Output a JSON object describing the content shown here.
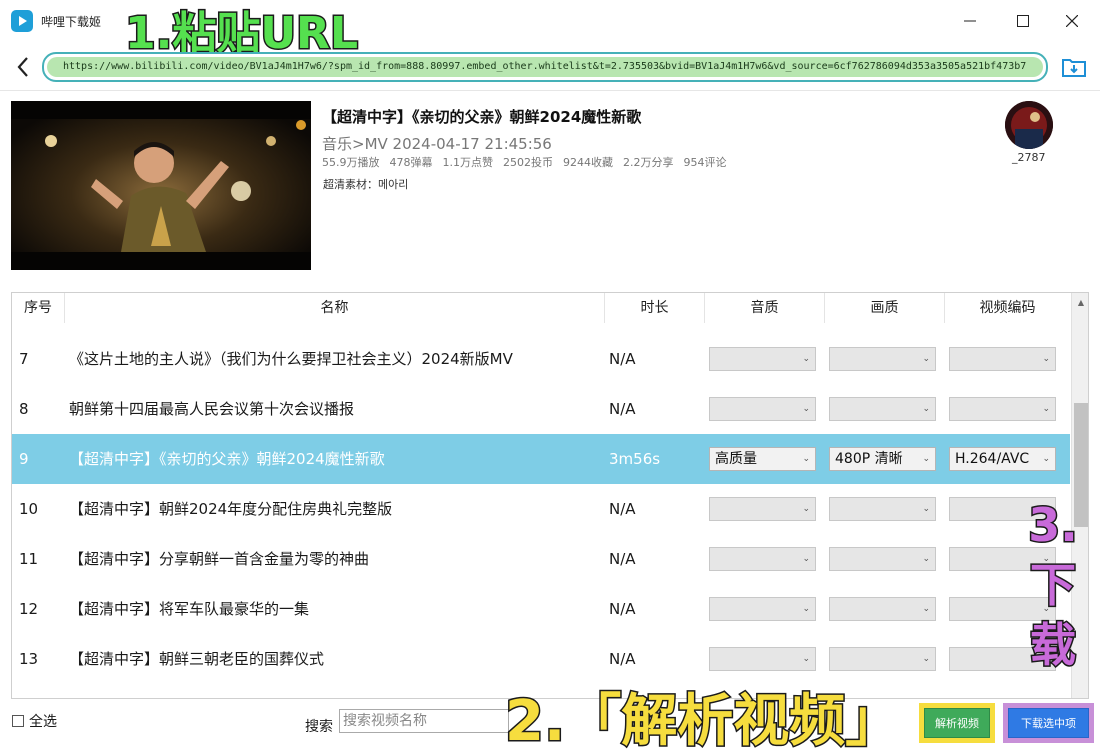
{
  "window": {
    "title": "哔哩下载姬",
    "controls": {
      "minimize": "—",
      "maximize": "☐",
      "close": "✕"
    }
  },
  "annotations": {
    "step1": "1.粘贴URL",
    "step2": "2.「解析视频」",
    "step3": "3. 下 载"
  },
  "url_bar": {
    "value": "https://www.bilibili.com/video/BV1aJ4m1H7w6/?spm_id_from=888.80997.embed_other.whitelist&t=2.735503&bvid=BV1aJ4m1H7w6&vd_source=6cf762786094d353a3505a521bf473b7"
  },
  "video": {
    "title": "【超清中字】《亲切的父亲》朝鲜2024魔性新歌",
    "meta": "音乐>MV  2024-04-17 21:45:56",
    "stats": [
      "55.9万播放",
      "478弹幕",
      "1.1万点赞",
      "2502投币",
      "9244收藏",
      "2.2万分享",
      "954评论"
    ],
    "material": "超清素材：메아리",
    "uploader": "_2787"
  },
  "table": {
    "headers": {
      "index": "序号",
      "name": "名称",
      "duration": "时长",
      "audio": "音质",
      "quality": "画质",
      "codec": "视频编码"
    },
    "rows": [
      {
        "index": "7",
        "name": "《这片土地的主人说》（我们为什么要捍卫社会主义）2024新版MV",
        "duration": "N/A",
        "audio": "",
        "quality": "",
        "codec": "",
        "selected": false
      },
      {
        "index": "8",
        "name": "朝鲜第十四届最高人民会议第十次会议播报",
        "duration": "N/A",
        "audio": "",
        "quality": "",
        "codec": "",
        "selected": false
      },
      {
        "index": "9",
        "name": "【超清中字】《亲切的父亲》朝鲜2024魔性新歌",
        "duration": "3m56s",
        "audio": "高质量",
        "quality": "480P 清晰",
        "codec": "H.264/AVC",
        "selected": true
      },
      {
        "index": "10",
        "name": "【超清中字】朝鲜2024年度分配住房典礼完整版",
        "duration": "N/A",
        "audio": "",
        "quality": "",
        "codec": "",
        "selected": false
      },
      {
        "index": "11",
        "name": "【超清中字】分享朝鲜一首含金量为零的神曲",
        "duration": "N/A",
        "audio": "",
        "quality": "",
        "codec": "",
        "selected": false
      },
      {
        "index": "12",
        "name": "【超清中字】将军车队最豪华的一集",
        "duration": "N/A",
        "audio": "",
        "quality": "",
        "codec": "",
        "selected": false
      },
      {
        "index": "13",
        "name": "【超清中字】朝鲜三朝老臣的国葬仪式",
        "duration": "N/A",
        "audio": "",
        "quality": "",
        "codec": "",
        "selected": false
      }
    ]
  },
  "bottom": {
    "select_all": "全选",
    "search_label": "搜索",
    "search_placeholder": "搜索视频名称",
    "parse_button": "解析视频",
    "download_button": "下载选中项"
  },
  "colors": {
    "selected_row": "#7ecde6",
    "primary_button": "#2f7ae4",
    "url_highlight": "#b8e6b0",
    "annotation_green": "#55e04f",
    "annotation_yellow": "#f6dd3e",
    "annotation_purple": "#c86ad9"
  },
  "icons": [
    "app-logo-icon",
    "back-arrow-icon",
    "download-folder-icon",
    "chevron-down-icon",
    "scroll-up-icon"
  ]
}
